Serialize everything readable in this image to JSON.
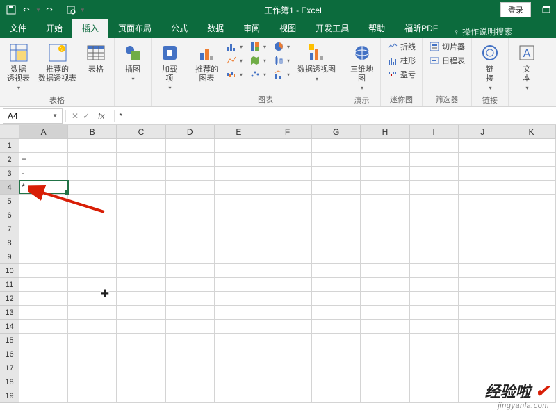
{
  "title_bar": {
    "doc_title": "工作簿1 - Excel",
    "login": "登录"
  },
  "tabs": {
    "file": "文件",
    "home": "开始",
    "insert": "插入",
    "layout": "页面布局",
    "formulas": "公式",
    "data": "数据",
    "review": "审阅",
    "view": "视图",
    "dev": "开发工具",
    "help": "帮助",
    "foxit": "福昕PDF",
    "tell_me": "操作说明搜索"
  },
  "ribbon": {
    "tables": {
      "pivot": "数据\n透视表",
      "recommend_pivot": "推荐的\n数据透视表",
      "table": "表格",
      "group": "表格"
    },
    "illus": {
      "btn": "插图",
      "group": ""
    },
    "addins": {
      "btn": "加载\n项",
      "group": ""
    },
    "charts": {
      "recommend": "推荐的\n图表",
      "pivot_chart": "数据透视图",
      "group": "图表"
    },
    "tours": {
      "map3d": "三维地\n图",
      "group": "演示"
    },
    "sparklines": {
      "line": "折线",
      "column": "柱形",
      "winloss": "盈亏",
      "group": "迷你图"
    },
    "filters": {
      "slicer": "切片器",
      "timeline": "日程表",
      "group": "筛选器"
    },
    "links": {
      "link": "链\n接",
      "group": "链接"
    },
    "text": {
      "textbox": "文\n本",
      "group": ""
    }
  },
  "formula_bar": {
    "name_box": "A4",
    "formula": "*"
  },
  "grid": {
    "cols": [
      "A",
      "B",
      "C",
      "D",
      "E",
      "F",
      "G",
      "H",
      "I",
      "J",
      "K"
    ],
    "rows": [
      "1",
      "2",
      "3",
      "4",
      "5",
      "6",
      "7",
      "8",
      "9",
      "10",
      "11",
      "12",
      "13",
      "14",
      "15",
      "16",
      "17",
      "18",
      "19"
    ],
    "sel_col": 0,
    "sel_row": 3,
    "cells": {
      "A2": "+",
      "A3": "-",
      "A4": "*"
    }
  },
  "watermark": {
    "main": "经验啦",
    "sub": "jingyanla.com"
  }
}
